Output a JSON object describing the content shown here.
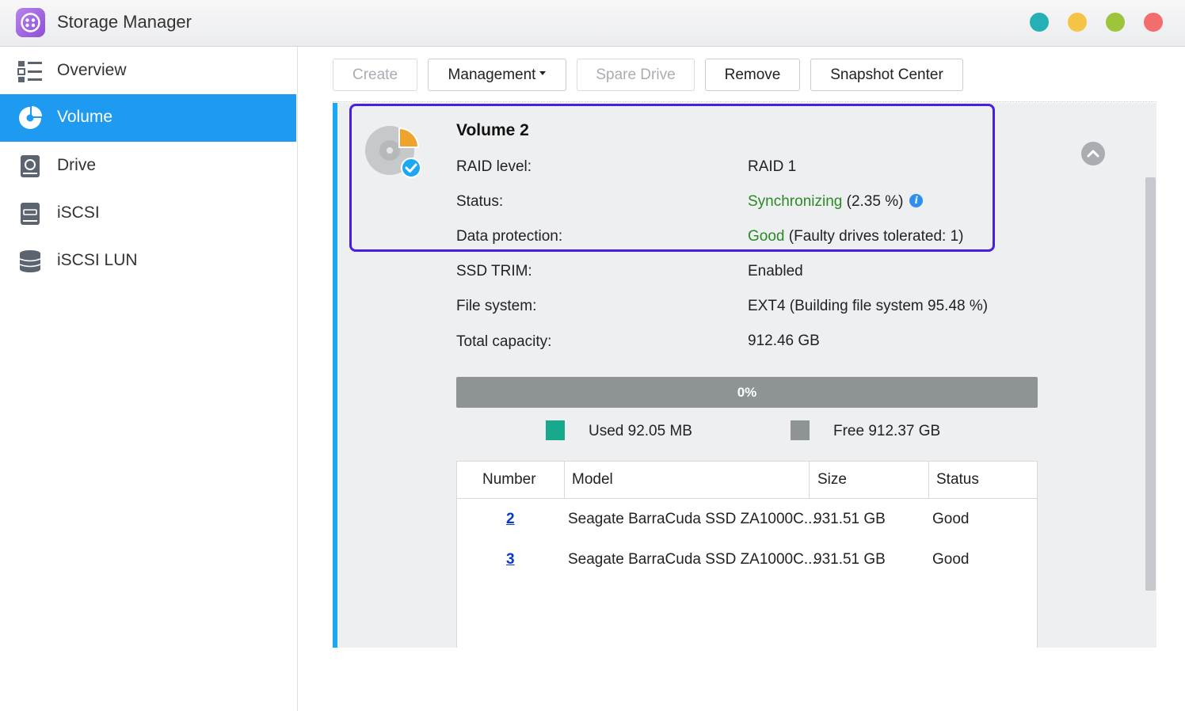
{
  "window": {
    "title": "Storage Manager",
    "controls": [
      {
        "name": "teal",
        "color": "#25b0b5"
      },
      {
        "name": "yellow",
        "color": "#f6c444"
      },
      {
        "name": "green",
        "color": "#9dc43b"
      },
      {
        "name": "red",
        "color": "#f26e6e"
      }
    ]
  },
  "sidebar": {
    "items": [
      {
        "label": "Overview",
        "icon": "list-icon",
        "active": false
      },
      {
        "label": "Volume",
        "icon": "volume-pie-icon",
        "active": true
      },
      {
        "label": "Drive",
        "icon": "hard-drive-icon",
        "active": false
      },
      {
        "label": "iSCSI",
        "icon": "iscsi-icon",
        "active": false
      },
      {
        "label": "iSCSI LUN",
        "icon": "database-icon",
        "active": false
      }
    ]
  },
  "toolbar": {
    "create": "Create",
    "management": "Management",
    "spare_drive": "Spare Drive",
    "remove": "Remove",
    "snapshot_center": "Snapshot Center"
  },
  "volume": {
    "name": "Volume 2",
    "raid_label": "RAID level:",
    "raid_value": "RAID 1",
    "status_label": "Status:",
    "status_value": "Synchronizing",
    "status_detail": "(2.35 %)",
    "info_glyph": "i",
    "protection_label": "Data protection:",
    "protection_value": "Good",
    "protection_detail": "(Faulty drives tolerated: 1)",
    "trim_label": "SSD TRIM:",
    "trim_value": "Enabled",
    "fs_label": "File system:",
    "fs_value": "EXT4 (Building file system 95.48 %)",
    "capacity_label": "Total capacity:",
    "capacity_value": "912.46 GB"
  },
  "usage": {
    "percent_text": "0%",
    "used_fraction": 0.0001,
    "used_label": "Used 92.05 MB",
    "free_label": "Free 912.37 GB",
    "used_color": "#17a98c",
    "free_color": "#8e9396"
  },
  "drives_table": {
    "headers": [
      "Number",
      "Model",
      "Size",
      "Status"
    ],
    "rows": [
      {
        "number": "2",
        "model": "Seagate BarraCuda SSD ZA1000C...",
        "size": "931.51 GB",
        "status": "Good"
      },
      {
        "number": "3",
        "model": "Seagate BarraCuda SSD ZA1000C...",
        "size": "931.51 GB",
        "status": "Good"
      }
    ]
  }
}
